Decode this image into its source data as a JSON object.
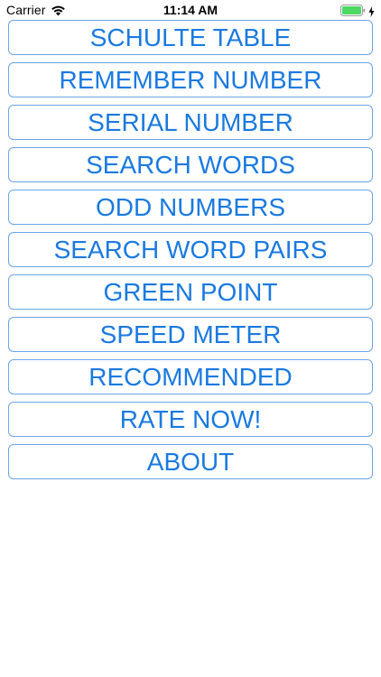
{
  "status_bar": {
    "carrier": "Carrier",
    "time": "11:14 AM",
    "wifi_icon": "wifi-icon",
    "battery_icon": "battery-full-icon",
    "charging_icon": "charging-bolt-icon",
    "battery_color": "#4cd964"
  },
  "colors": {
    "accent": "#1a7ae0",
    "button_border": "#6aa5e6",
    "background": "#ffffff"
  },
  "menu": {
    "items": [
      {
        "label": "SCHULTE TABLE"
      },
      {
        "label": "REMEMBER NUMBER"
      },
      {
        "label": "SERIAL NUMBER"
      },
      {
        "label": "SEARCH WORDS"
      },
      {
        "label": "ODD NUMBERS"
      },
      {
        "label": "SEARCH WORD PAIRS"
      },
      {
        "label": "GREEN POINT"
      },
      {
        "label": "SPEED METER"
      },
      {
        "label": "RECOMMENDED"
      },
      {
        "label": "RATE NOW!"
      },
      {
        "label": "ABOUT"
      }
    ]
  }
}
